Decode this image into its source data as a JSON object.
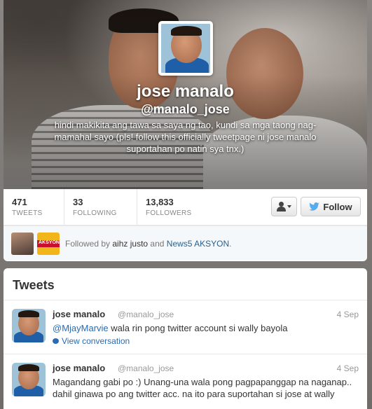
{
  "profile": {
    "name": "jose manalo",
    "handle": "@manalo_jose",
    "bio": "hindi makikita ang tawa sa saya ng tao, kundi sa mga taong nag-mamahal sayo (pls! follow this officially tweetpage ni jose manalo suportahan po natin sya tnx.)"
  },
  "stats": {
    "tweets": {
      "value": "471",
      "label": "TWEETS"
    },
    "following": {
      "value": "33",
      "label": "FOLLOWING"
    },
    "followers": {
      "value": "13,833",
      "label": "FOLLOWERS"
    }
  },
  "actions": {
    "follow_label": "Follow"
  },
  "followed_by": {
    "prefix": "Followed by",
    "user1": "aihz justo",
    "conjunction": "and",
    "user2": "News5 AKSYON",
    "suffix": ".",
    "avatar2_text": "AKSYON"
  },
  "timeline": {
    "title": "Tweets",
    "tweets": [
      {
        "name": "jose manalo",
        "handle": "@manalo_jose",
        "time": "4 Sep",
        "mention": "@MjayMarvie",
        "text": " wala rin pong twitter account si wally bayola",
        "link": "View conversation"
      },
      {
        "name": "jose manalo",
        "handle": "@manalo_jose",
        "time": "4 Sep",
        "text": "Magandang gabi po :) Unang-una wala pong pagpapanggap na naganap.. dahil ginawa po ang twitter acc. na ito para suportahan si jose at wally"
      }
    ]
  },
  "colors": {
    "link": "#2a6bb1",
    "follow_bird": "#55acee"
  }
}
